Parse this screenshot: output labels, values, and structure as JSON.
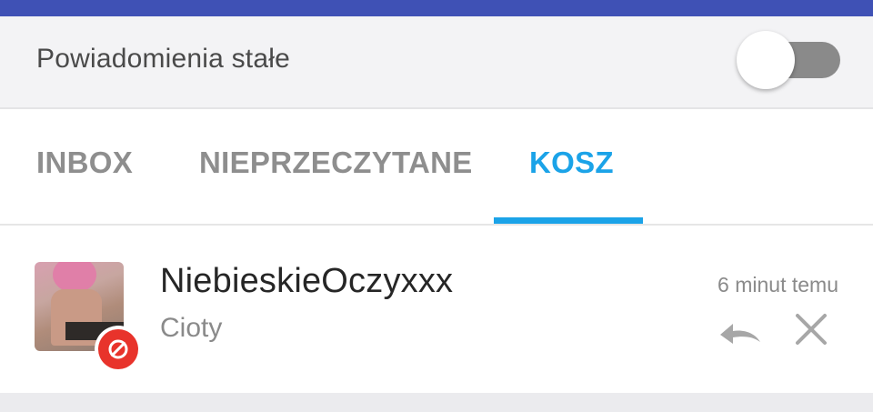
{
  "settings": {
    "persistent_notifications_label": "Powiadomienia stałe",
    "persistent_notifications_on": false
  },
  "tabs": [
    {
      "label": "INBOX",
      "active": false
    },
    {
      "label": "NIEPRZECZYTANE",
      "active": false
    },
    {
      "label": "KOSZ",
      "active": true
    }
  ],
  "messages": [
    {
      "sender": "NiebieskieOczyxxx",
      "subject": "Cioty",
      "time": "6 minut temu",
      "blocked": true,
      "actions": [
        "undo-icon",
        "close-icon"
      ]
    }
  ],
  "colors": {
    "app_bar": "#3f51b5",
    "accent": "#1ba3e8",
    "block_badge": "#e8332b",
    "toggle_off_track": "#8a8a8a"
  }
}
